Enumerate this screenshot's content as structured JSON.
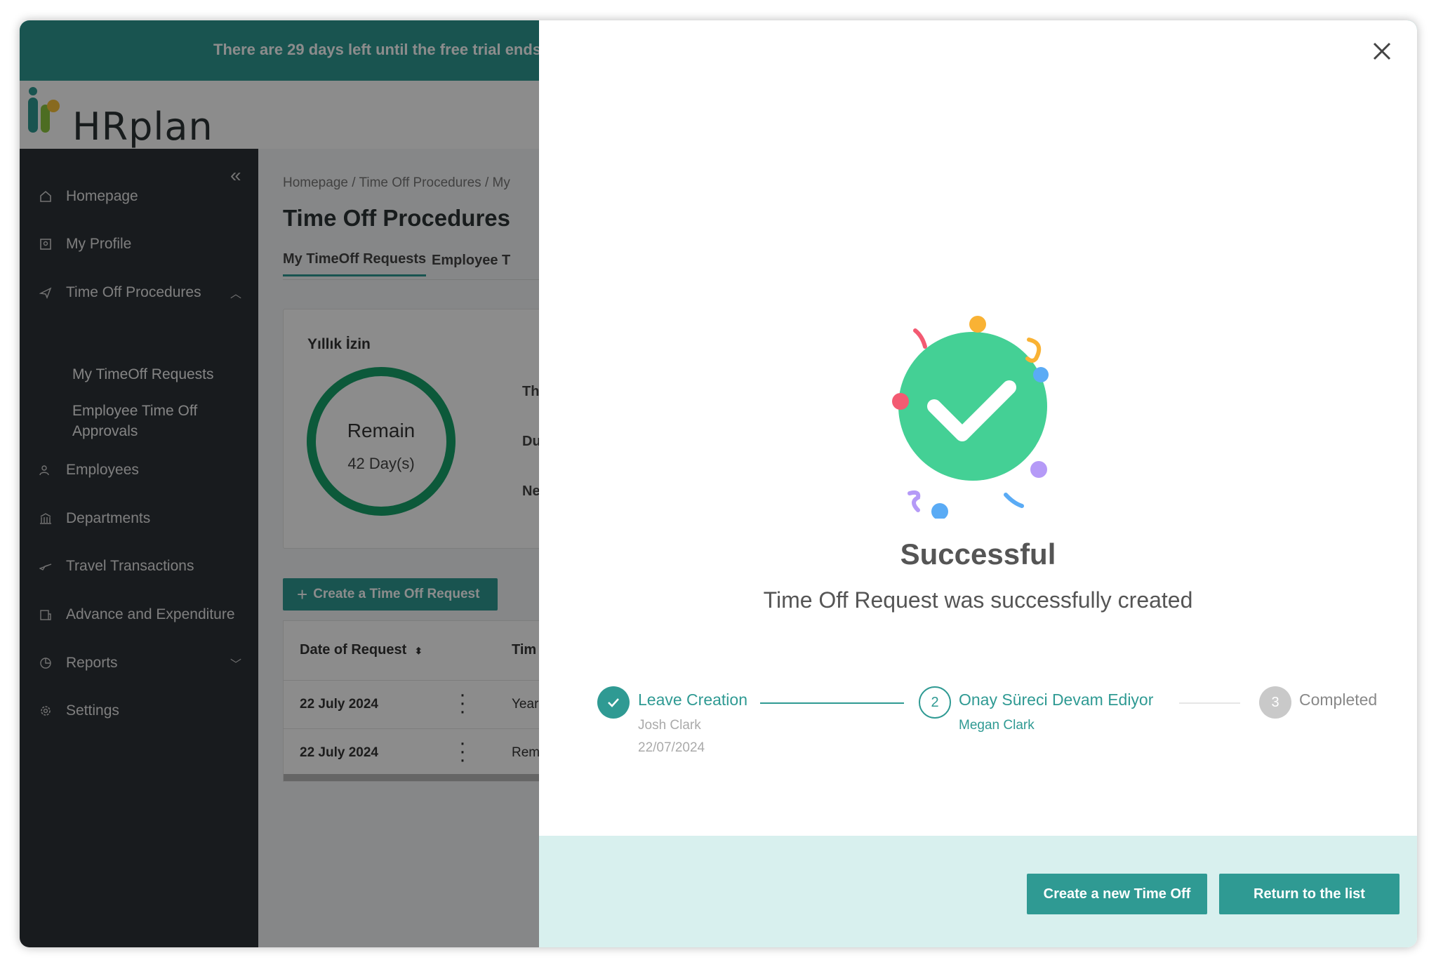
{
  "banner": {
    "text": "There are 29 days left until the free trial ends!"
  },
  "logo": {
    "text": "HRplan"
  },
  "sidebar": {
    "collapse_icon": "double-chevron-left-icon",
    "items": [
      {
        "label": "Homepage",
        "icon": "home-icon"
      },
      {
        "label": "My Profile",
        "icon": "profile-icon"
      },
      {
        "label": "Time Off Procedures",
        "icon": "airplane-icon"
      },
      {
        "label": "Employees",
        "icon": "users-icon"
      },
      {
        "label": "Departments",
        "icon": "building-icon"
      },
      {
        "label": "Travel Transactions",
        "icon": "travel-icon"
      },
      {
        "label": "Advance and Expenditure",
        "icon": "wallet-icon"
      },
      {
        "label": "Reports",
        "icon": "chart-icon"
      },
      {
        "label": "Settings",
        "icon": "gear-icon"
      }
    ],
    "sub_items": [
      {
        "label": "My TimeOff Requests"
      },
      {
        "label": "Employee Time Off Approvals"
      }
    ]
  },
  "main": {
    "breadcrumb": "Homepage  /  Time Off Procedures  /  My",
    "title": "Time Off Procedures",
    "tabs": [
      {
        "label": "My TimeOff Requests"
      },
      {
        "label": "Employee T"
      }
    ],
    "card": {
      "title": "Yıllık İzin",
      "ring_label": "Remain",
      "ring_value": "42 Day(s)",
      "info": [
        "Th",
        "Du",
        "Ne"
      ]
    },
    "create_button": "Create a Time Off Request",
    "table": {
      "headers": [
        "Date of Request",
        "Tim"
      ],
      "rows": [
        {
          "date": "22 July 2024",
          "type": "Year"
        },
        {
          "date": "22 July 2024",
          "type": "Rem"
        }
      ]
    }
  },
  "modal": {
    "title": "Successful",
    "message": "Time Off Request was successfully created",
    "steps": [
      {
        "label": "Leave Creation",
        "person": "Josh Clark",
        "date": "22/07/2024",
        "status": "done"
      },
      {
        "number": "2",
        "label": "Onay Süreci Devam Ediyor",
        "person": "Megan Clark",
        "status": "active"
      },
      {
        "number": "3",
        "label": "Completed",
        "status": "pending"
      }
    ],
    "buttons": {
      "new": "Create a new Time Off",
      "return": "Return to the list"
    }
  },
  "colors": {
    "accent": "#2f9a93",
    "success": "#44d095",
    "sidebar": "#2d3238"
  }
}
